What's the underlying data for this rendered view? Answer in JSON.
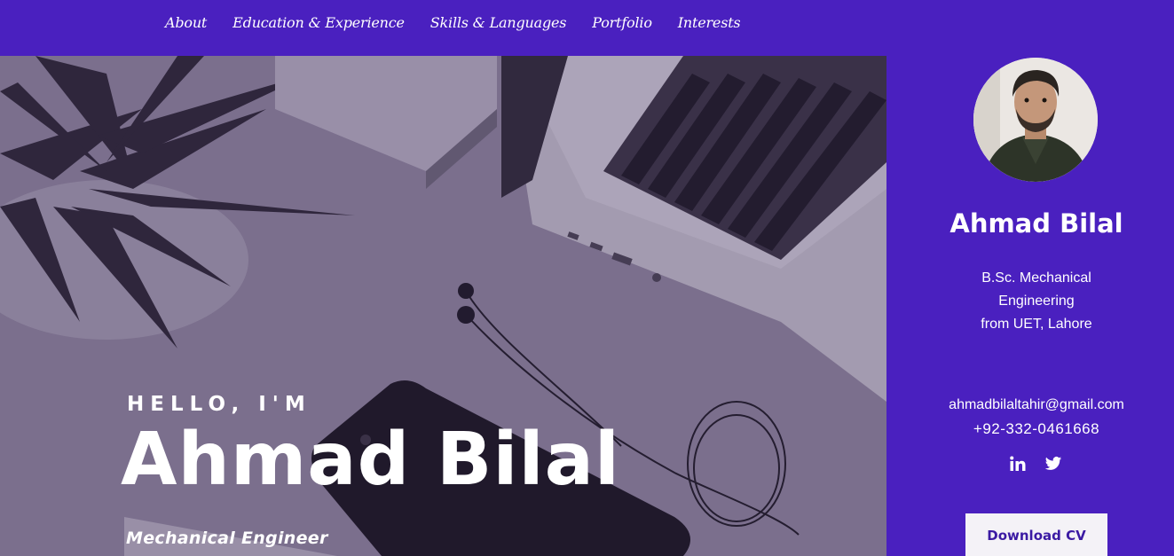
{
  "nav": {
    "items": [
      {
        "label": "About"
      },
      {
        "label": "Education & Experience"
      },
      {
        "label": "Skills & Languages"
      },
      {
        "label": "Portfolio"
      },
      {
        "label": "Interests"
      }
    ]
  },
  "hero": {
    "greeting": "HELLO, I'M",
    "name": "Ahmad Bilal",
    "role": "Mechanical Engineer"
  },
  "sidebar": {
    "name": "Ahmad Bilal",
    "degree_line1": "B.Sc. Mechanical",
    "degree_line2": "Engineering",
    "degree_line3": "from UET, Lahore",
    "email": "ahmadbilaltahir@gmail.com",
    "phone": "+92-332-0461668",
    "download_label": "Download CV",
    "socials": [
      {
        "icon": "linkedin-icon"
      },
      {
        "icon": "twitter-icon"
      }
    ]
  },
  "colors": {
    "brand_purple": "#4a20bf",
    "button_bg": "#f4f2f7",
    "button_text": "#3b1aa3"
  }
}
